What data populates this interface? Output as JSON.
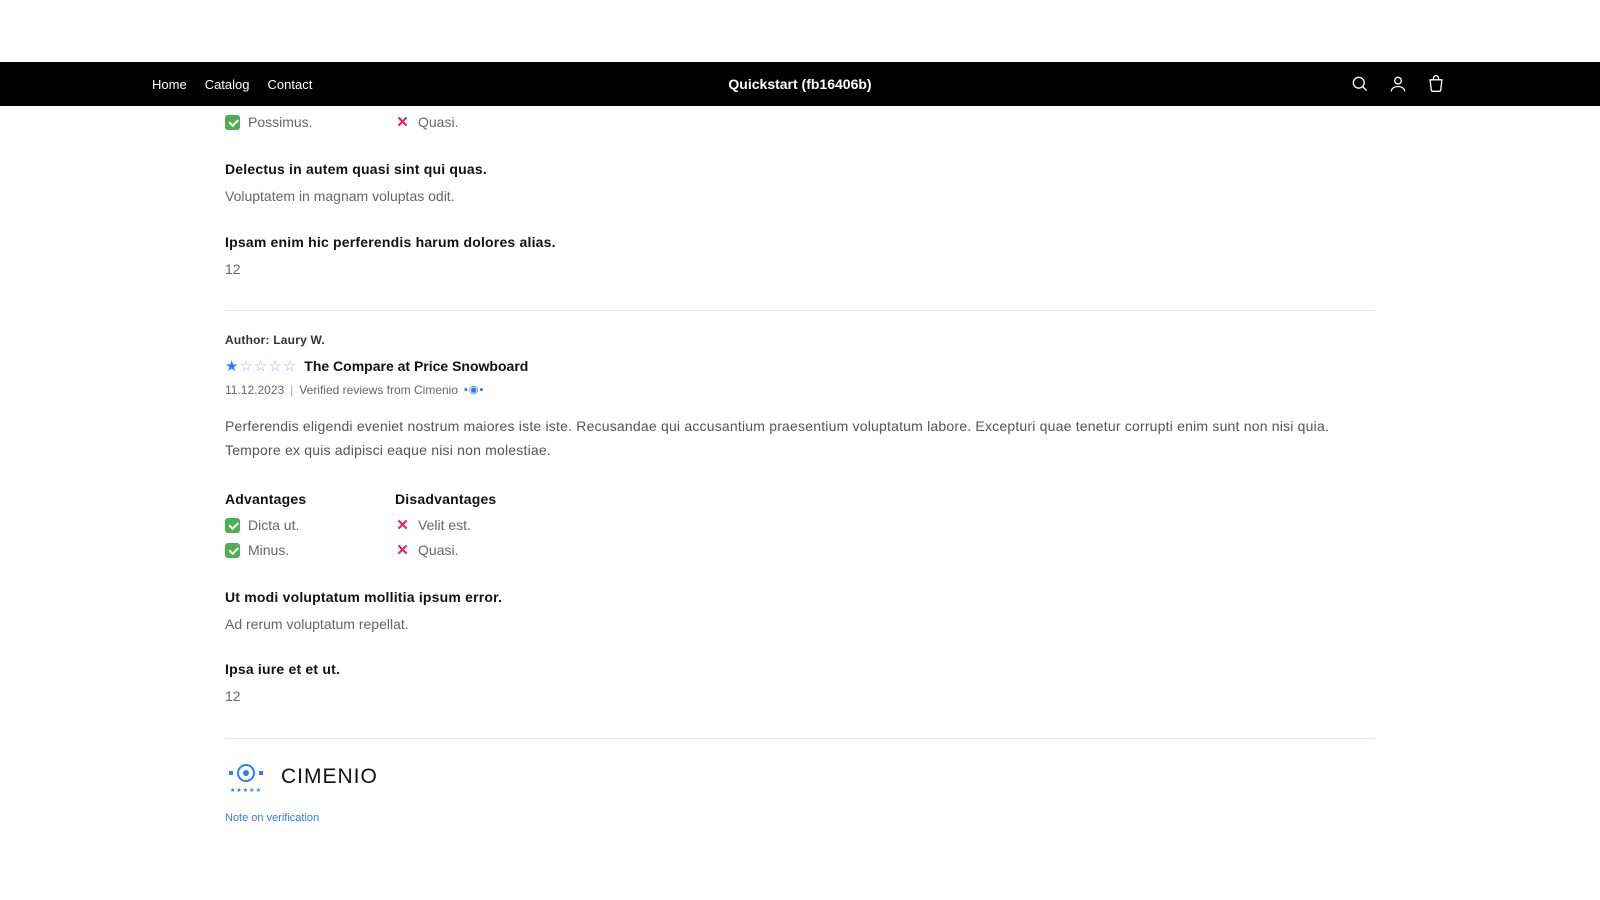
{
  "nav": {
    "home": "Home",
    "catalog": "Catalog",
    "contact": "Contact",
    "title": "Quickstart (fb16406b)"
  },
  "review1": {
    "adv_item": "Possimus.",
    "dis_item": "Quasi.",
    "q1": "Delectus in autem quasi sint qui quas.",
    "a1": "Voluptatem in magnam voluptas odit.",
    "q2": "Ipsam enim hic perferendis harum dolores alias.",
    "a2": "12"
  },
  "review2": {
    "author_label": "Author: ",
    "author_name": "Laury W.",
    "product_title": "The Compare at Price Snowboard",
    "date": "11.12.2023",
    "verified_text": "Verified reviews from Cimenio",
    "body": "Perferendis eligendi eveniet nostrum maiores iste iste. Recusandae qui accusantium praesentium voluptatum labore. Excepturi quae tenetur corrupti enim sunt non nisi quia. Tempore ex quis adipisci eaque nisi non molestiae.",
    "advantages_label": "Advantages",
    "disadvantages_label": "Disadvantages",
    "adv1": "Dicta ut.",
    "adv2": "Minus.",
    "dis1": "Velit est.",
    "dis2": "Quasi.",
    "q1": "Ut modi voluptatum mollitia ipsum error.",
    "a1": "Ad rerum voluptatum repellat.",
    "q2": "Ipsa iure et et ut.",
    "a2": "12"
  },
  "footer": {
    "brand": "CIMENIO",
    "note_link": "Note on verification"
  }
}
